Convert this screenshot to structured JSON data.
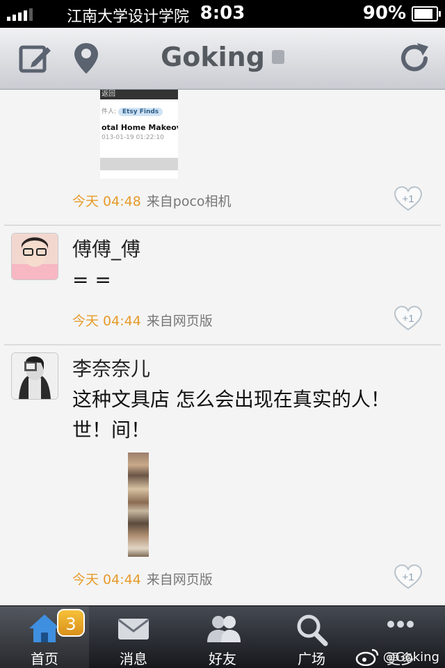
{
  "status": {
    "carrier": "江南大学设计学院",
    "time": "8:03",
    "battery": "90%",
    "battery_level": 0.9
  },
  "navbar": {
    "title": "Goking"
  },
  "posts": [
    {
      "thumb": {
        "bar": "返回",
        "to_label": "件人:",
        "chip": "Etsy Finds",
        "subject": "otal Home Makeover",
        "date": "013-01-19 01:22:10"
      },
      "time": "今天 04:48",
      "source": "来自poco相机",
      "like": "+1"
    },
    {
      "name": "傅傅_傅",
      "text": "= =",
      "time": "今天 04:44",
      "source": "来自网页版",
      "like": "+1"
    },
    {
      "name": "李奈奈儿",
      "text": "这种文具店 怎么会出现在真实的人！世！间！",
      "time": "今天 04:44",
      "source": "来自网页版",
      "like": "+1"
    }
  ],
  "tabbar": {
    "items": [
      {
        "label": "首页",
        "icon": "home-icon",
        "badge": "3"
      },
      {
        "label": "消息",
        "icon": "mail-icon"
      },
      {
        "label": "好友",
        "icon": "friends-icon"
      },
      {
        "label": "广场",
        "icon": "search-icon"
      },
      {
        "label": "更多",
        "icon": "more-icon"
      }
    ]
  },
  "watermark": "@Goking",
  "colors": {
    "time_orange": "#e69b2a",
    "badge": "#f0a92b",
    "navbar": "#d8dade"
  }
}
